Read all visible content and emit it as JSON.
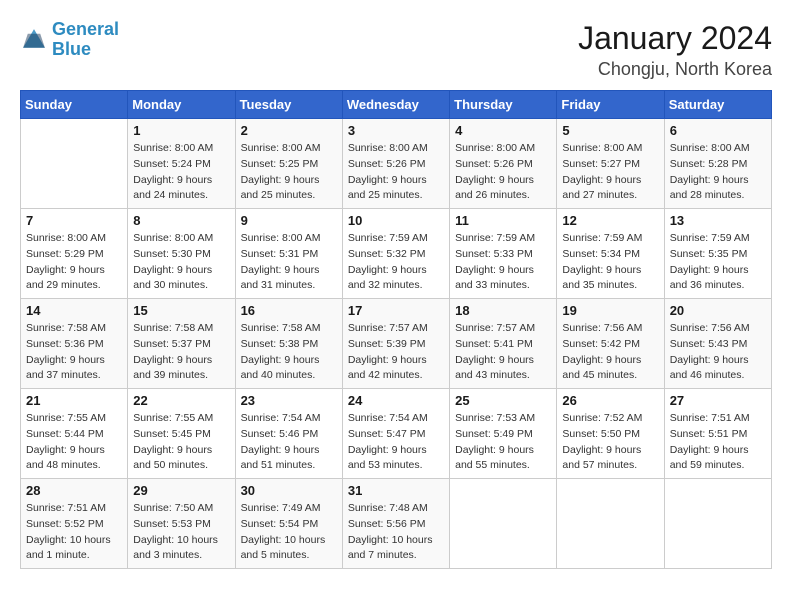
{
  "header": {
    "logo_line1": "General",
    "logo_line2": "Blue",
    "title": "January 2024",
    "subtitle": "Chongju, North Korea"
  },
  "weekdays": [
    "Sunday",
    "Monday",
    "Tuesday",
    "Wednesday",
    "Thursday",
    "Friday",
    "Saturday"
  ],
  "weeks": [
    [
      {
        "num": "",
        "detail": ""
      },
      {
        "num": "1",
        "detail": "Sunrise: 8:00 AM\nSunset: 5:24 PM\nDaylight: 9 hours\nand 24 minutes."
      },
      {
        "num": "2",
        "detail": "Sunrise: 8:00 AM\nSunset: 5:25 PM\nDaylight: 9 hours\nand 25 minutes."
      },
      {
        "num": "3",
        "detail": "Sunrise: 8:00 AM\nSunset: 5:26 PM\nDaylight: 9 hours\nand 25 minutes."
      },
      {
        "num": "4",
        "detail": "Sunrise: 8:00 AM\nSunset: 5:26 PM\nDaylight: 9 hours\nand 26 minutes."
      },
      {
        "num": "5",
        "detail": "Sunrise: 8:00 AM\nSunset: 5:27 PM\nDaylight: 9 hours\nand 27 minutes."
      },
      {
        "num": "6",
        "detail": "Sunrise: 8:00 AM\nSunset: 5:28 PM\nDaylight: 9 hours\nand 28 minutes."
      }
    ],
    [
      {
        "num": "7",
        "detail": "Sunrise: 8:00 AM\nSunset: 5:29 PM\nDaylight: 9 hours\nand 29 minutes."
      },
      {
        "num": "8",
        "detail": "Sunrise: 8:00 AM\nSunset: 5:30 PM\nDaylight: 9 hours\nand 30 minutes."
      },
      {
        "num": "9",
        "detail": "Sunrise: 8:00 AM\nSunset: 5:31 PM\nDaylight: 9 hours\nand 31 minutes."
      },
      {
        "num": "10",
        "detail": "Sunrise: 7:59 AM\nSunset: 5:32 PM\nDaylight: 9 hours\nand 32 minutes."
      },
      {
        "num": "11",
        "detail": "Sunrise: 7:59 AM\nSunset: 5:33 PM\nDaylight: 9 hours\nand 33 minutes."
      },
      {
        "num": "12",
        "detail": "Sunrise: 7:59 AM\nSunset: 5:34 PM\nDaylight: 9 hours\nand 35 minutes."
      },
      {
        "num": "13",
        "detail": "Sunrise: 7:59 AM\nSunset: 5:35 PM\nDaylight: 9 hours\nand 36 minutes."
      }
    ],
    [
      {
        "num": "14",
        "detail": "Sunrise: 7:58 AM\nSunset: 5:36 PM\nDaylight: 9 hours\nand 37 minutes."
      },
      {
        "num": "15",
        "detail": "Sunrise: 7:58 AM\nSunset: 5:37 PM\nDaylight: 9 hours\nand 39 minutes."
      },
      {
        "num": "16",
        "detail": "Sunrise: 7:58 AM\nSunset: 5:38 PM\nDaylight: 9 hours\nand 40 minutes."
      },
      {
        "num": "17",
        "detail": "Sunrise: 7:57 AM\nSunset: 5:39 PM\nDaylight: 9 hours\nand 42 minutes."
      },
      {
        "num": "18",
        "detail": "Sunrise: 7:57 AM\nSunset: 5:41 PM\nDaylight: 9 hours\nand 43 minutes."
      },
      {
        "num": "19",
        "detail": "Sunrise: 7:56 AM\nSunset: 5:42 PM\nDaylight: 9 hours\nand 45 minutes."
      },
      {
        "num": "20",
        "detail": "Sunrise: 7:56 AM\nSunset: 5:43 PM\nDaylight: 9 hours\nand 46 minutes."
      }
    ],
    [
      {
        "num": "21",
        "detail": "Sunrise: 7:55 AM\nSunset: 5:44 PM\nDaylight: 9 hours\nand 48 minutes."
      },
      {
        "num": "22",
        "detail": "Sunrise: 7:55 AM\nSunset: 5:45 PM\nDaylight: 9 hours\nand 50 minutes."
      },
      {
        "num": "23",
        "detail": "Sunrise: 7:54 AM\nSunset: 5:46 PM\nDaylight: 9 hours\nand 51 minutes."
      },
      {
        "num": "24",
        "detail": "Sunrise: 7:54 AM\nSunset: 5:47 PM\nDaylight: 9 hours\nand 53 minutes."
      },
      {
        "num": "25",
        "detail": "Sunrise: 7:53 AM\nSunset: 5:49 PM\nDaylight: 9 hours\nand 55 minutes."
      },
      {
        "num": "26",
        "detail": "Sunrise: 7:52 AM\nSunset: 5:50 PM\nDaylight: 9 hours\nand 57 minutes."
      },
      {
        "num": "27",
        "detail": "Sunrise: 7:51 AM\nSunset: 5:51 PM\nDaylight: 9 hours\nand 59 minutes."
      }
    ],
    [
      {
        "num": "28",
        "detail": "Sunrise: 7:51 AM\nSunset: 5:52 PM\nDaylight: 10 hours\nand 1 minute."
      },
      {
        "num": "29",
        "detail": "Sunrise: 7:50 AM\nSunset: 5:53 PM\nDaylight: 10 hours\nand 3 minutes."
      },
      {
        "num": "30",
        "detail": "Sunrise: 7:49 AM\nSunset: 5:54 PM\nDaylight: 10 hours\nand 5 minutes."
      },
      {
        "num": "31",
        "detail": "Sunrise: 7:48 AM\nSunset: 5:56 PM\nDaylight: 10 hours\nand 7 minutes."
      },
      {
        "num": "",
        "detail": ""
      },
      {
        "num": "",
        "detail": ""
      },
      {
        "num": "",
        "detail": ""
      }
    ]
  ]
}
